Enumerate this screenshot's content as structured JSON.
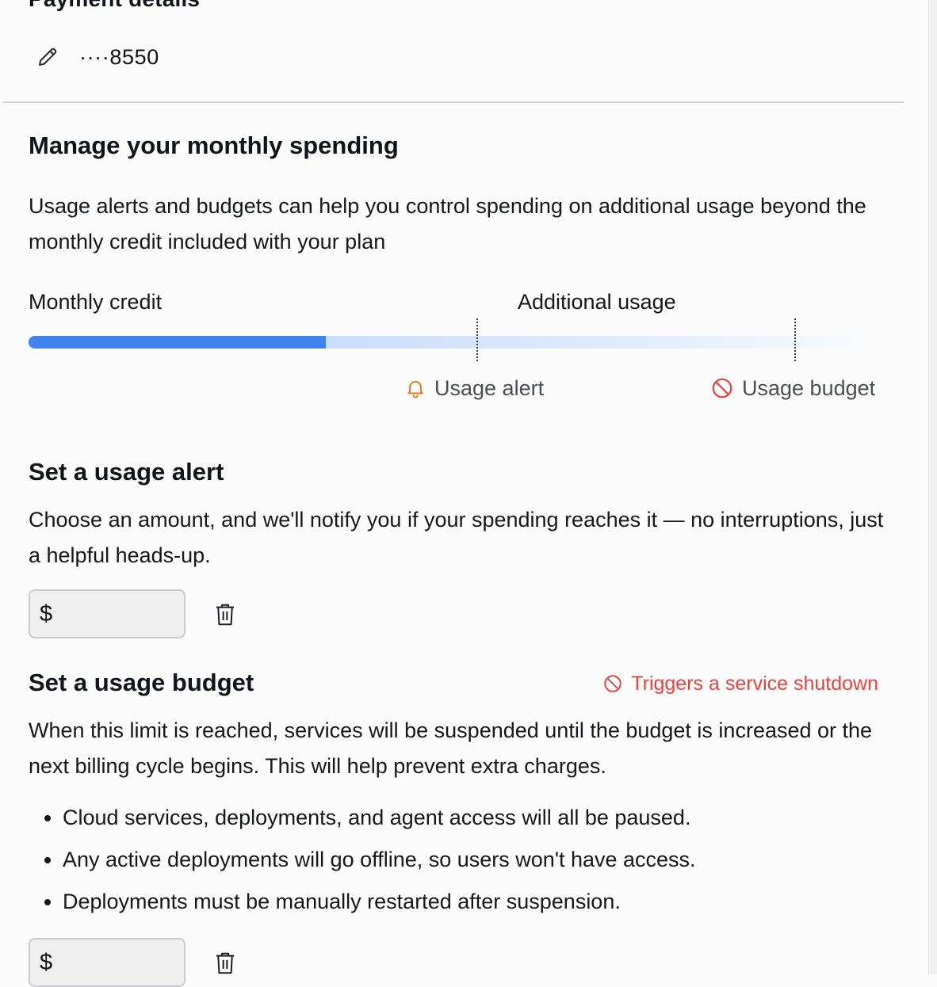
{
  "payment": {
    "title": "Payment details",
    "card_number": "····8550"
  },
  "spending": {
    "title": "Manage your monthly spending",
    "description": "Usage alerts and budgets can help you control spending on additional usage beyond the monthly credit included with your plan",
    "bar": {
      "label_monthly_credit": "Monthly credit",
      "label_additional_usage": "Additional usage",
      "credit_used_fraction": 0.35,
      "alert_marker_label": "Usage alert",
      "budget_marker_label": "Usage budget",
      "fill_color": "#3f83ec"
    }
  },
  "usage_alert": {
    "title": "Set a usage alert",
    "description": "Choose an amount, and we'll notify you if your spending reaches it — no interruptions, just a helpful heads-up.",
    "currency_symbol": "$",
    "value": ""
  },
  "usage_budget": {
    "title": "Set a usage budget",
    "warning": "Triggers a service shutdown",
    "warning_color": "#e0463f",
    "description": "When this limit is reached, services will be suspended until the budget is increased or the next billing cycle begins. This will help prevent extra charges.",
    "bullets": [
      "Cloud services, deployments, and agent access will all be paused.",
      "Any active deployments will go offline, so users won't have access.",
      "Deployments must be manually restarted after suspension."
    ],
    "currency_symbol": "$",
    "value": ""
  }
}
